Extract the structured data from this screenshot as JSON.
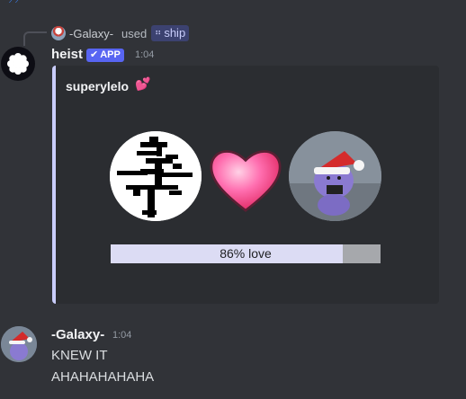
{
  "top": {
    "text": "",
    "icon": "audio-wave-icon"
  },
  "reply": {
    "user": "-Galaxy-",
    "used_label": "used",
    "command": "ship",
    "command_icon": "slash-command-icon"
  },
  "bot": {
    "name": "heist",
    "badge": "APP",
    "timestamp": "1:04",
    "avatar_icon": "white-flower-icon"
  },
  "embed": {
    "title": "superylelo",
    "title_emoji": "two-hearts-icon",
    "accent_color": "#c9cdfb",
    "left_avatar": "black-glyph-avatar",
    "heart": "pink-heart-icon",
    "right_avatar": "purple-plush-santa-hat-avatar",
    "love_label": "86% love",
    "love_fraction": 0.86,
    "bar_fill_color": "#dcdcf4",
    "bar_empty_color": "#a6a8ac"
  },
  "message": {
    "user": "-Galaxy-",
    "timestamp": "1:04",
    "lines": [
      "KNEW IT",
      "AHAHAHAHAHA"
    ],
    "avatar": "santa-hat-avatar"
  }
}
